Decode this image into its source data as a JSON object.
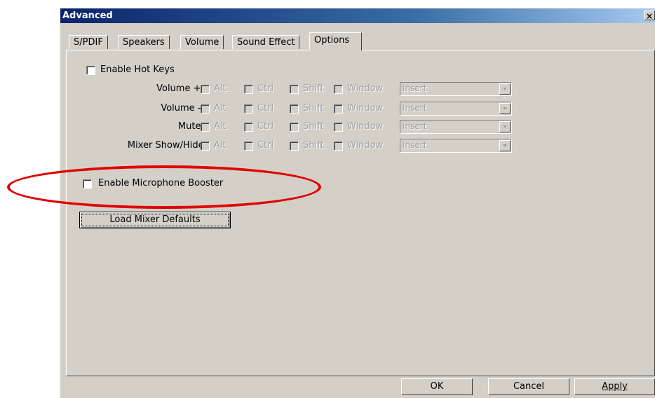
{
  "window": {
    "title": "Advanced",
    "close_glyph": "×"
  },
  "tabs": [
    {
      "label": "S/PDIF"
    },
    {
      "label": "Speakers"
    },
    {
      "label": "Volume"
    },
    {
      "label": "Sound Effect"
    },
    {
      "label": "Options"
    }
  ],
  "active_tab": "Options",
  "hotkeys": {
    "enable_label": "Enable Hot Keys",
    "enabled": false,
    "modifier_labels": {
      "alt": "Alt",
      "ctrl": "Ctrl",
      "shift": "Shift",
      "window": "Window"
    },
    "rows": [
      {
        "label": "Volume + :",
        "key": "Insert"
      },
      {
        "label": "Volume - :",
        "key": "Insert"
      },
      {
        "label": "Mute :",
        "key": "Insert"
      },
      {
        "label": "Mixer Show/Hide:",
        "key": "Insert"
      }
    ]
  },
  "mic_booster": {
    "label": "Enable Microphone Booster",
    "checked": false
  },
  "load_defaults_label": "Load Mixer Defaults",
  "footer": {
    "ok": "OK",
    "cancel": "Cancel",
    "apply": "Apply"
  },
  "annotation": {
    "color": "#e00000"
  }
}
